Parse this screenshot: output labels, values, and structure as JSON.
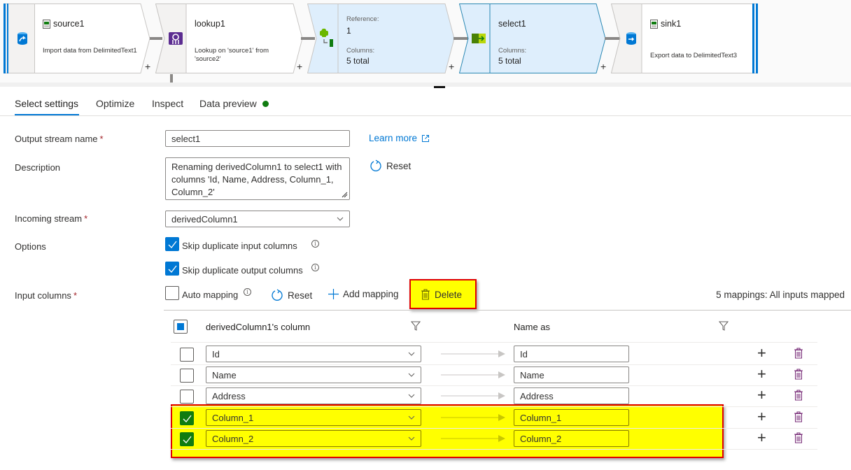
{
  "pipeline": {
    "nodes": [
      {
        "id": "source1",
        "title": "source1",
        "title_icon": "csv-file-icon",
        "type_icon": "source-database-icon",
        "description": "Import data from DelimitedText1",
        "selected": false
      },
      {
        "id": "lookup1",
        "title": "lookup1",
        "type_icon": "lookup-icon",
        "description": "Lookup on 'source1' from 'source2'",
        "selected": false
      },
      {
        "id": "reference",
        "type_icon": "reference-join-icon",
        "reference_label": "Reference:",
        "reference_value": "1",
        "columns_label": "Columns:",
        "columns_value": "5 total",
        "selected": false
      },
      {
        "id": "select1",
        "title": "select1",
        "type_icon": "select-icon",
        "columns_label": "Columns:",
        "columns_value": "5 total",
        "selected": true
      },
      {
        "id": "sink1",
        "title": "sink1",
        "title_icon": "csv-file-icon",
        "type_icon": "sink-database-icon",
        "description": "Export data to DelimitedText3",
        "selected": false
      }
    ],
    "add_label": "+"
  },
  "tabs": [
    {
      "label": "Select settings",
      "active": true
    },
    {
      "label": "Optimize",
      "active": false
    },
    {
      "label": "Inspect",
      "active": false
    },
    {
      "label": "Data preview",
      "active": false,
      "status": "green-dot"
    }
  ],
  "form": {
    "output_stream_name": {
      "label": "Output stream name",
      "required": "*",
      "value": "select1"
    },
    "learn_more": "Learn more",
    "description": {
      "label": "Description",
      "value": "Renaming derivedColumn1 to select1 with columns 'Id, Name, Address, Column_1, Column_2'"
    },
    "reset_label": "Reset",
    "incoming_stream": {
      "label": "Incoming stream",
      "required": "*",
      "value": "derivedColumn1"
    },
    "options": {
      "label": "Options",
      "skip_duplicate_input": {
        "label": "Skip duplicate input columns",
        "checked": true
      },
      "skip_duplicate_output": {
        "label": "Skip duplicate output columns",
        "checked": true
      }
    },
    "input_columns": {
      "label": "Input columns",
      "required": "*",
      "auto_mapping": {
        "label": "Auto mapping",
        "checked": false
      },
      "reset_label": "Reset",
      "add_mapping_label": "Add mapping",
      "delete_label": "Delete",
      "status": "5 mappings: All inputs mapped"
    }
  },
  "mapping_grid": {
    "header_checkbox": "indeterminate",
    "source_column_header": "derivedColumn1's column",
    "name_as_header": "Name as",
    "rows": [
      {
        "source": "Id",
        "name_as": "Id",
        "selected": false
      },
      {
        "source": "Name",
        "name_as": "Name",
        "selected": false
      },
      {
        "source": "Address",
        "name_as": "Address",
        "selected": false
      },
      {
        "source": "Column_1",
        "name_as": "Column_1",
        "selected": true
      },
      {
        "source": "Column_2",
        "name_as": "Column_2",
        "selected": true
      }
    ]
  },
  "colors": {
    "accent": "#0078d4",
    "highlight": "#ffff00",
    "highlight_border": "#e00000",
    "checked_row": "#107c10",
    "selected_node": "#deeefc"
  }
}
